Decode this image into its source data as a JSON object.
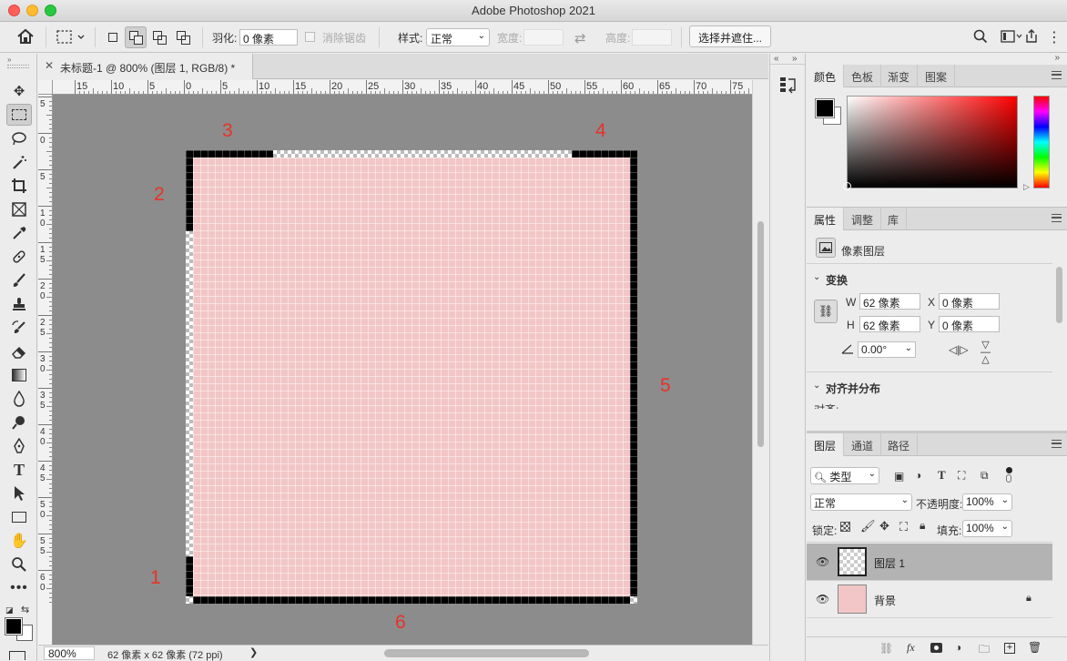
{
  "app": {
    "title": "Adobe Photoshop 2021"
  },
  "options_bar": {
    "feather_label": "羽化:",
    "feather_value": "0 像素",
    "antialias_label": "消除锯齿",
    "style_label": "样式:",
    "style_value": "正常",
    "width_label": "宽度:",
    "height_label": "高度:",
    "select_mask_button": "选择并遮住..."
  },
  "document": {
    "tab_title": "未标题-1 @ 800% (图层 1, RGB/8) *",
    "zoom": "800%",
    "info": "62 像素 x 62 像素 (72 ppi)",
    "canvas_color": "#f2c6c6",
    "annotations": [
      "1",
      "2",
      "3",
      "4",
      "5",
      "6"
    ]
  },
  "rulers": {
    "top": [
      "15",
      "10",
      "5",
      "0",
      "5",
      "10",
      "15",
      "20",
      "25",
      "30",
      "35",
      "40",
      "45",
      "50",
      "55",
      "60",
      "65",
      "70",
      "75"
    ],
    "left": [
      "5",
      "0",
      "5",
      "1 0",
      "1 5",
      "2 0",
      "2 5",
      "3 0",
      "3 5",
      "4 0",
      "4 5",
      "5 0",
      "5 5",
      "6 0"
    ]
  },
  "tools": [
    "move-tool",
    "marquee-tool",
    "lasso-tool",
    "magic-wand-tool",
    "crop-tool",
    "frame-tool",
    "eyedropper-tool",
    "healing-brush-tool",
    "brush-tool",
    "clone-stamp-tool",
    "history-brush-tool",
    "eraser-tool",
    "gradient-tool",
    "blur-tool",
    "dodge-tool",
    "pen-tool",
    "type-tool",
    "path-selection-tool",
    "rectangle-tool",
    "hand-tool",
    "zoom-tool",
    "more-tools"
  ],
  "color_panel": {
    "tabs": [
      "颜色",
      "色板",
      "渐变",
      "图案"
    ],
    "foreground": "#000000",
    "background": "#ffffff",
    "hue_color": "#ff0000"
  },
  "properties_panel": {
    "tabs": [
      "属性",
      "调整",
      "库"
    ],
    "layer_type": "像素图层",
    "transform_title": "变换",
    "w_label": "W",
    "w_value": "62 像素",
    "h_label": "H",
    "h_value": "62 像素",
    "x_label": "X",
    "x_value": "0 像素",
    "y_label": "Y",
    "y_value": "0 像素",
    "angle_value": "0.00°",
    "align_title": "对齐并分布",
    "align_sub": "对齐:"
  },
  "layers_panel": {
    "tabs": [
      "图层",
      "通道",
      "路径"
    ],
    "filter_kind": "类型",
    "blend_mode": "正常",
    "opacity_label": "不透明度:",
    "opacity_value": "100%",
    "lock_label": "锁定:",
    "fill_label": "填充:",
    "fill_value": "100%",
    "layers": [
      {
        "name": "图层 1",
        "selected": true
      },
      {
        "name": "背景",
        "selected": false,
        "locked": true
      }
    ]
  }
}
